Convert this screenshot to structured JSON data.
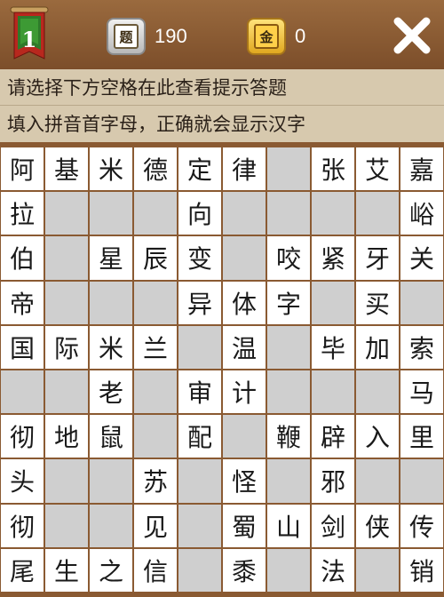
{
  "header": {
    "level": "1",
    "questions_icon": "题",
    "questions_count": "190",
    "gold_icon": "金",
    "gold_count": "0"
  },
  "hints": {
    "line1": "请选择下方空格在此查看提示答题",
    "line2": "填入拼音首字母，正确就会显示汉字"
  },
  "grid": {
    "rows": [
      [
        "阿",
        "基",
        "米",
        "德",
        "定",
        "律",
        "",
        "张",
        "艾",
        "嘉"
      ],
      [
        "拉",
        "",
        "",
        "",
        "向",
        "",
        "",
        "",
        "",
        "峪"
      ],
      [
        "伯",
        "",
        "星",
        "辰",
        "变",
        "",
        "咬",
        "紧",
        "牙",
        "关"
      ],
      [
        "帝",
        "",
        "",
        "",
        "异",
        "体",
        "字",
        "",
        "买",
        ""
      ],
      [
        "国",
        "际",
        "米",
        "兰",
        "",
        "温",
        "",
        "毕",
        "加",
        "索"
      ],
      [
        "",
        "",
        "老",
        "",
        "审",
        "计",
        "",
        "",
        "",
        "马"
      ],
      [
        "彻",
        "地",
        "鼠",
        "",
        "配",
        "",
        "鞭",
        "辟",
        "入",
        "里"
      ],
      [
        "头",
        "",
        "",
        "苏",
        "",
        "怪",
        "",
        "邪",
        "",
        ""
      ],
      [
        "彻",
        "",
        "",
        "见",
        "",
        "蜀",
        "山",
        "剑",
        "侠",
        "传"
      ],
      [
        "尾",
        "生",
        "之",
        "信",
        "",
        "黍",
        "",
        "法",
        "",
        "销"
      ]
    ]
  },
  "colors": {
    "background_wood": "#8a5a32",
    "hint_panel": "#d7c9ae",
    "cell_filled": "#ffffff",
    "cell_blank": "#cfcfcf",
    "badge_red": "#b8281e",
    "badge_green": "#2f7a2a"
  },
  "icons": {
    "level": "banner-icon",
    "questions": "question-card-icon",
    "gold": "gold-coin-icon",
    "close": "close-icon"
  }
}
